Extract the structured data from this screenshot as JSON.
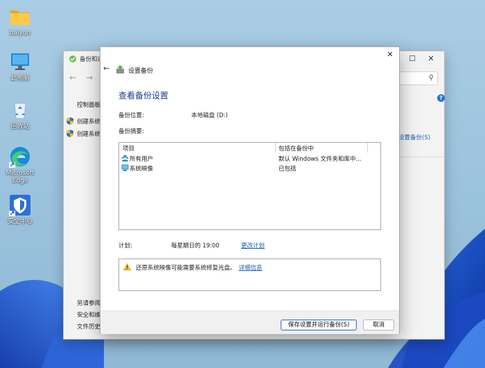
{
  "desktop": {
    "icons": [
      {
        "label": "baiyun",
        "icon": "folder-icon"
      },
      {
        "label": "此电脑",
        "icon": "monitor-icon"
      },
      {
        "label": "回收站",
        "icon": "recycle-bin-icon"
      },
      {
        "label": "Microsoft Edge",
        "icon": "edge-icon"
      },
      {
        "label": "安全中心",
        "icon": "security-center-icon"
      }
    ]
  },
  "bg_window": {
    "title": "备份和还",
    "sidebar_heading": "控制面板",
    "sidebar_items": [
      "创建系统",
      "创建系统"
    ],
    "see_also_heading": "另请参阅",
    "see_also_items": [
      "安全和维",
      "文件历史"
    ],
    "right_link": "设置备份(S)"
  },
  "dialog": {
    "title": "设置备份",
    "heading": "查看备份设置",
    "location_label": "备份位置:",
    "location_value": "本地磁盘 (D:)",
    "summary_label": "备份摘要:",
    "list": {
      "columns": [
        "项目",
        "包括在备份中"
      ],
      "rows": [
        {
          "name": "所有用户",
          "value": "默认 Windows 文件夹和库中...",
          "icon": "users-icon"
        },
        {
          "name": "系统映像",
          "value": "已包括",
          "icon": "system-image-icon"
        }
      ]
    },
    "schedule_label": "计划:",
    "schedule_value": "每星期日的 19:00",
    "schedule_link": "更改计划",
    "warning_text": "还原系统映像可能需要系统修复光盘。",
    "warning_link": "详细信息",
    "buttons": {
      "save": "保存设置并运行备份(S)",
      "cancel": "取消"
    }
  },
  "colors": {
    "heading": "#1d3c8f",
    "link": "#1a5fb4",
    "primary_button_border": "#4a79c9"
  }
}
